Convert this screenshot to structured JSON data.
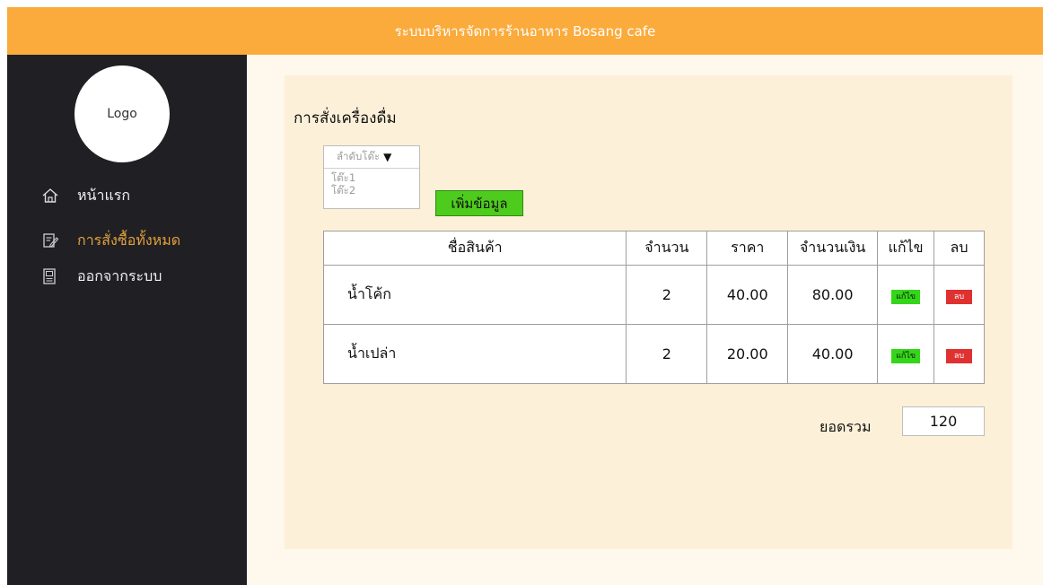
{
  "header": {
    "title": "ระบบบริหารจัดการร้านอาหาร Bosang cafe",
    "background": "#fbab3c"
  },
  "sidebar": {
    "logo_text": "Logo",
    "items": [
      {
        "label": "หน้าแรก",
        "icon": "home-icon",
        "active": false
      },
      {
        "label": "การสั่งซื้อทั้งหมด",
        "icon": "edit-document-icon",
        "active": true
      },
      {
        "label": "ออกจากระบบ",
        "icon": "logout-icon",
        "active": false
      }
    ],
    "active_color": "#e2a23a",
    "background": "#201f24"
  },
  "main": {
    "title": "การสั่งเครื่องดื่ม",
    "table_select": {
      "placeholder": "ลำดับโต๊ะ",
      "options": [
        "โต๊ะ1",
        "โต๊ะ2"
      ]
    },
    "add_button_label": "เพิ่มข้อมูล",
    "table": {
      "headers": [
        "ชื่อสินค้า",
        "จำนวน",
        "ราคา",
        "จำนวนเงิน",
        "แก้ไข",
        "ลบ"
      ],
      "rows": [
        {
          "name": "น้ำโค้ก",
          "qty": "2",
          "price": "40.00",
          "amount": "80.00",
          "edit": "แก้ไข",
          "delete": "ลบ"
        },
        {
          "name": "น้ำเปล่า",
          "qty": "2",
          "price": "20.00",
          "amount": "40.00",
          "edit": "แก้ไข",
          "delete": "ลบ"
        }
      ]
    },
    "total_label": "ยอดรวม",
    "total_value": "120"
  },
  "colors": {
    "add_button": "#4ecc1e",
    "edit_button": "#34d61a",
    "delete_button": "#e03131",
    "content_background": "#fcf0d8"
  }
}
